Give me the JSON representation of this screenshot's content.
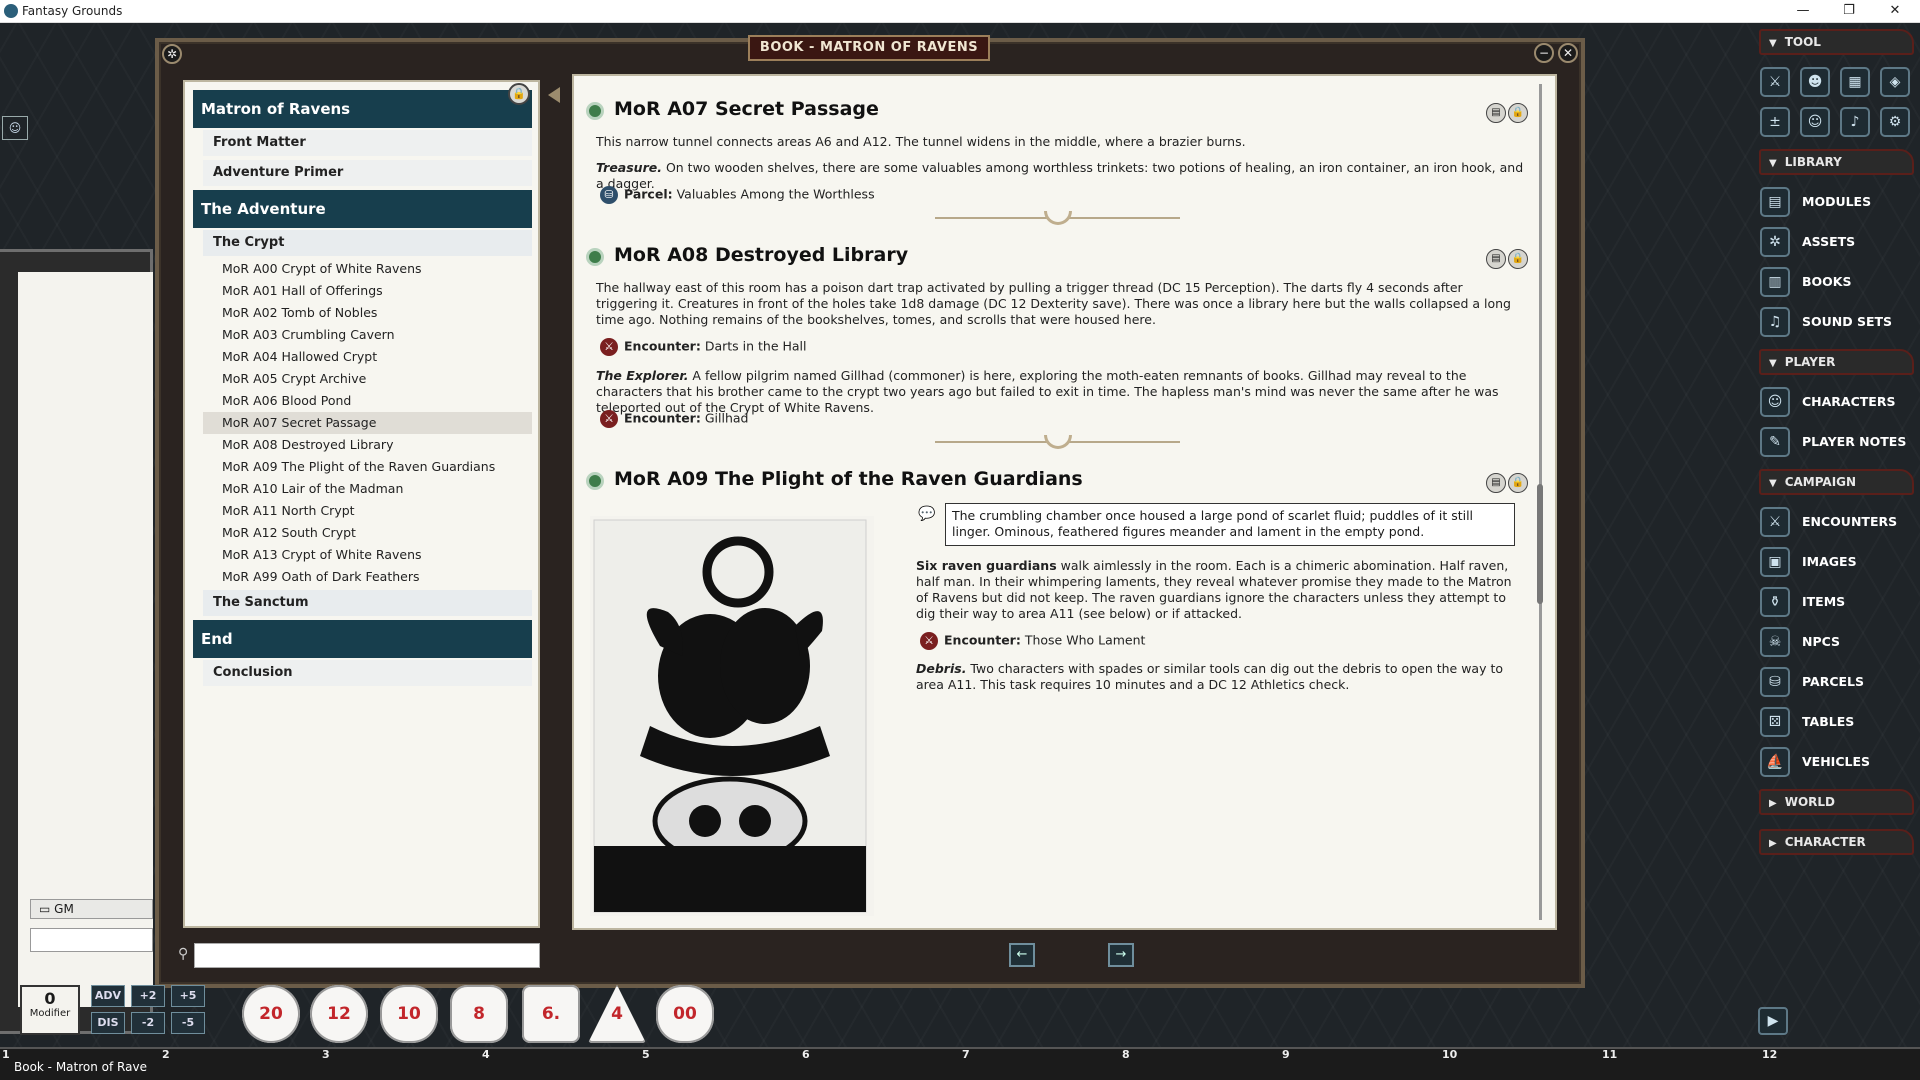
{
  "app": {
    "title": "Fantasy Grounds",
    "minimize": "—",
    "restore": "❐",
    "close": "✕"
  },
  "book": {
    "title": "BOOK - MATRON OF RAVENS",
    "index": {
      "chapter1": "Matron of Ravens",
      "front_matter": "Front Matter",
      "adventure_primer": "Adventure Primer",
      "chapter2": "The Adventure",
      "the_crypt": "The Crypt",
      "entries": [
        "MoR A00 Crypt of White Ravens",
        "MoR A01 Hall of Offerings",
        "MoR A02 Tomb of Nobles",
        "MoR A03 Crumbling Cavern",
        "MoR A04 Hallowed Crypt",
        "MoR A05 Crypt Archive",
        "MoR A06 Blood Pond",
        "MoR A07 Secret Passage",
        "MoR A08 Destroyed Library",
        "MoR A09 The Plight of the Raven Guardians",
        "MoR A10 Lair of the Madman",
        "MoR A11 North Crypt",
        "MoR A12 South Crypt",
        "MoR A13 Crypt of White Ravens",
        "MoR A99 Oath of Dark Feathers"
      ],
      "the_sanctum": "The Sanctum",
      "chapter3": "End",
      "conclusion": "Conclusion"
    },
    "sections": {
      "a07": {
        "title": "MoR A07 Secret Passage",
        "p1": "This narrow tunnel connects areas A6 and A12. The tunnel widens in the middle, where a brazier burns.",
        "p2_lead": "Treasure.",
        "p2": " On two wooden shelves, there are some valuables among worthless trinkets: two potions of healing, an iron container, an iron hook, and a dagger.",
        "link_label": "Parcel:",
        "link_text": " Valuables Among the Worthless"
      },
      "a08": {
        "title": "MoR A08 Destroyed Library",
        "p1": "The hallway east of this room has a poison dart trap activated by pulling a trigger thread (DC 15 Perception). The darts fly 4 seconds after triggering it. Creatures in front of the holes take 1d8 damage (DC 12 Dexterity save). There was once a library here but the walls collapsed a long time ago. Nothing remains of the bookshelves, tomes, and scrolls that were housed here.",
        "enc1_label": "Encounter:",
        "enc1_text": " Darts in the Hall",
        "p2_lead": "The Explorer.",
        "p2": " A fellow pilgrim named Gillhad (commoner) is here, exploring the moth-eaten remnants of books. Gillhad may reveal to the characters that his brother came to the crypt two years ago but failed to exit in time. The hapless man's mind was never the same after he was teleported out of the Crypt of White Ravens.",
        "enc2_label": "Encounter:",
        "enc2_text": " Gillhad"
      },
      "a09": {
        "title": "MoR A09 The Plight of the Raven Guardians",
        "quote": "The crumbling chamber once housed a large pond of scarlet fluid; puddles of it still linger. Ominous, feathered figures meander and lament in the empty pond.",
        "p1_lead": "Six raven guardians",
        "p1": " walk aimlessly in the room. Each is a chimeric abomination. Half raven, half man. In their whimpering laments, they reveal whatever promise they made to the Matron of Ravens but did not keep. The raven guardians ignore the characters unless they attempt to dig their way to area A11 (see below) or if attacked.",
        "enc_label": "Encounter:",
        "enc_text": " Those Who Lament",
        "p2_lead": "Debris.",
        "p2": " Two characters with spades or similar tools can dig out the debris to open the way to area A11. This task requires 10 minutes and a DC 12 Athletics check."
      }
    },
    "nav": {
      "prev": "←",
      "next": "→"
    }
  },
  "sidebar": {
    "tool_header": "TOOL",
    "library_header": "LIBRARY",
    "library": [
      "MODULES",
      "ASSETS",
      "BOOKS",
      "SOUND SETS"
    ],
    "player_header": "PLAYER",
    "player": [
      "CHARACTERS",
      "PLAYER NOTES"
    ],
    "campaign_header": "CAMPAIGN",
    "campaign": [
      "ENCOUNTERS",
      "IMAGES",
      "ITEMS",
      "NPCS",
      "PARCELS",
      "TABLES",
      "VEHICLES"
    ],
    "world_header": "WORLD",
    "character_header": "CHARACTER"
  },
  "chat": {
    "mode": "GM"
  },
  "modifier": {
    "value": "0",
    "label": "Modifier"
  },
  "mod_buttons": {
    "adv": "ADV",
    "dis": "DIS",
    "p2": "+2",
    "p5": "+5",
    "m2": "-2",
    "m5": "-5"
  },
  "dice": [
    "20",
    "12",
    "10",
    "8",
    "6.",
    "4",
    "00"
  ],
  "hotbar": {
    "label": "Book - Matron of Rave",
    "keys": [
      "1",
      "2",
      "3",
      "4",
      "5",
      "6",
      "7",
      "8",
      "9",
      "10",
      "11",
      "12"
    ]
  },
  "colors": {
    "index_header": "#173e4d",
    "title_bar": "#3a1712",
    "die_number": "#c2262b"
  }
}
